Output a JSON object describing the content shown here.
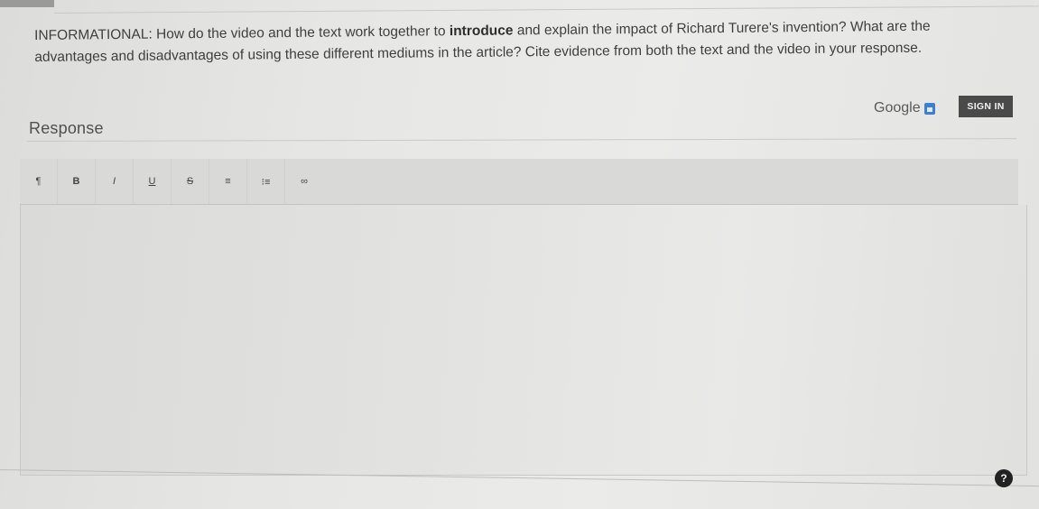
{
  "prompt": {
    "prefix": "INFORMATIONAL: How do the video and the text work together to ",
    "keyword": "introduce",
    "suffix": " and explain the impact of Richard Turere's invention? What are the advantages and disadvantages of using these different mediums in the article? Cite evidence from both the text and the video in your response."
  },
  "response": {
    "label": "Response"
  },
  "google": {
    "text": "Google",
    "icon": "google-drive-icon",
    "sign_in_label": "SIGN IN"
  },
  "toolbar": {
    "items": [
      {
        "glyph": "¶",
        "icon": "paragraph-icon"
      },
      {
        "glyph": "B",
        "icon": "bold-icon"
      },
      {
        "glyph": "I",
        "icon": "italic-icon"
      },
      {
        "glyph": "U",
        "icon": "underline-icon"
      },
      {
        "glyph": "S",
        "icon": "strikethrough-icon"
      },
      {
        "glyph": "≡",
        "icon": "bulleted-list-icon"
      },
      {
        "glyph": "⁝≡",
        "icon": "numbered-list-icon"
      },
      {
        "glyph": "∞",
        "icon": "link-icon"
      }
    ]
  },
  "editor": {
    "value": ""
  },
  "help": {
    "glyph": "?",
    "icon": "help-icon"
  },
  "colors": {
    "sign_in_bg": "#4a4a4a",
    "drive_blue": "#3b7fd6"
  }
}
